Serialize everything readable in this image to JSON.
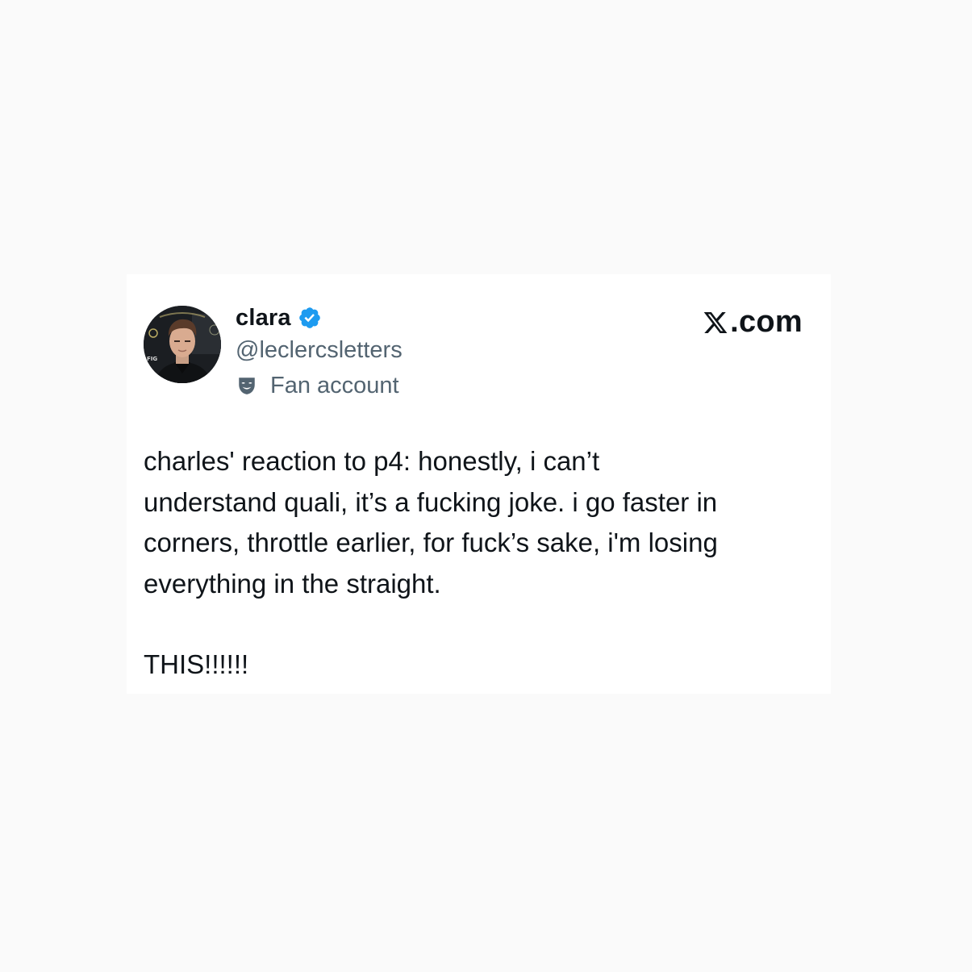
{
  "tweet": {
    "author": {
      "display_name": "clara",
      "handle": "@leclercsletters",
      "affiliation": "Fan account",
      "verified": true,
      "avatar_icon": "profile-photo",
      "verified_icon": "verified-badge-icon",
      "affiliation_icon": "theater-mask-icon"
    },
    "brand": {
      "logo": "x-logo-icon",
      "suffix": ".com"
    },
    "text": "charles' reaction to p4: honestly, i can’t\nunderstand quali, it’s a fucking joke. i go faster in\ncorners, throttle earlier, for fuck’s sake, i'm losing\neverything in the straight.",
    "text_followup": "THIS!!!!!!"
  },
  "colors": {
    "background": "#fafafa",
    "card": "#ffffff",
    "primary_text": "#0f1419",
    "secondary_text": "#536471",
    "verified_blue": "#1d9bf0"
  }
}
